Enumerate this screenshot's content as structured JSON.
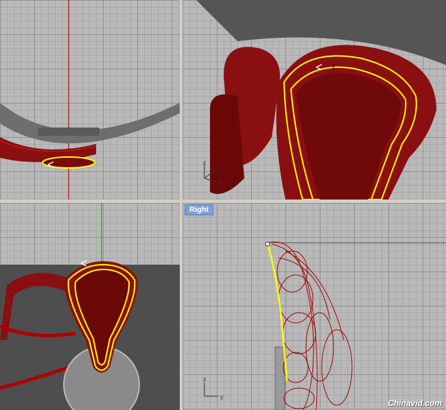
{
  "viewports": {
    "top": {
      "label": ""
    },
    "perspective": {
      "label": ""
    },
    "front": {
      "label": ""
    },
    "right": {
      "label": "Right"
    }
  },
  "axes": {
    "persp_z": "z",
    "persp_y": "y",
    "persp_x": "x",
    "right_z": "z",
    "right_y": "y"
  },
  "watermark": "Chinavid.com",
  "colors": {
    "grid_bg": "#b9b9b9",
    "surface_red": "#8a0f10",
    "wire_red": "#b00000",
    "selection_yellow": "#ffff00",
    "label_blue": "#7c9fd8"
  }
}
